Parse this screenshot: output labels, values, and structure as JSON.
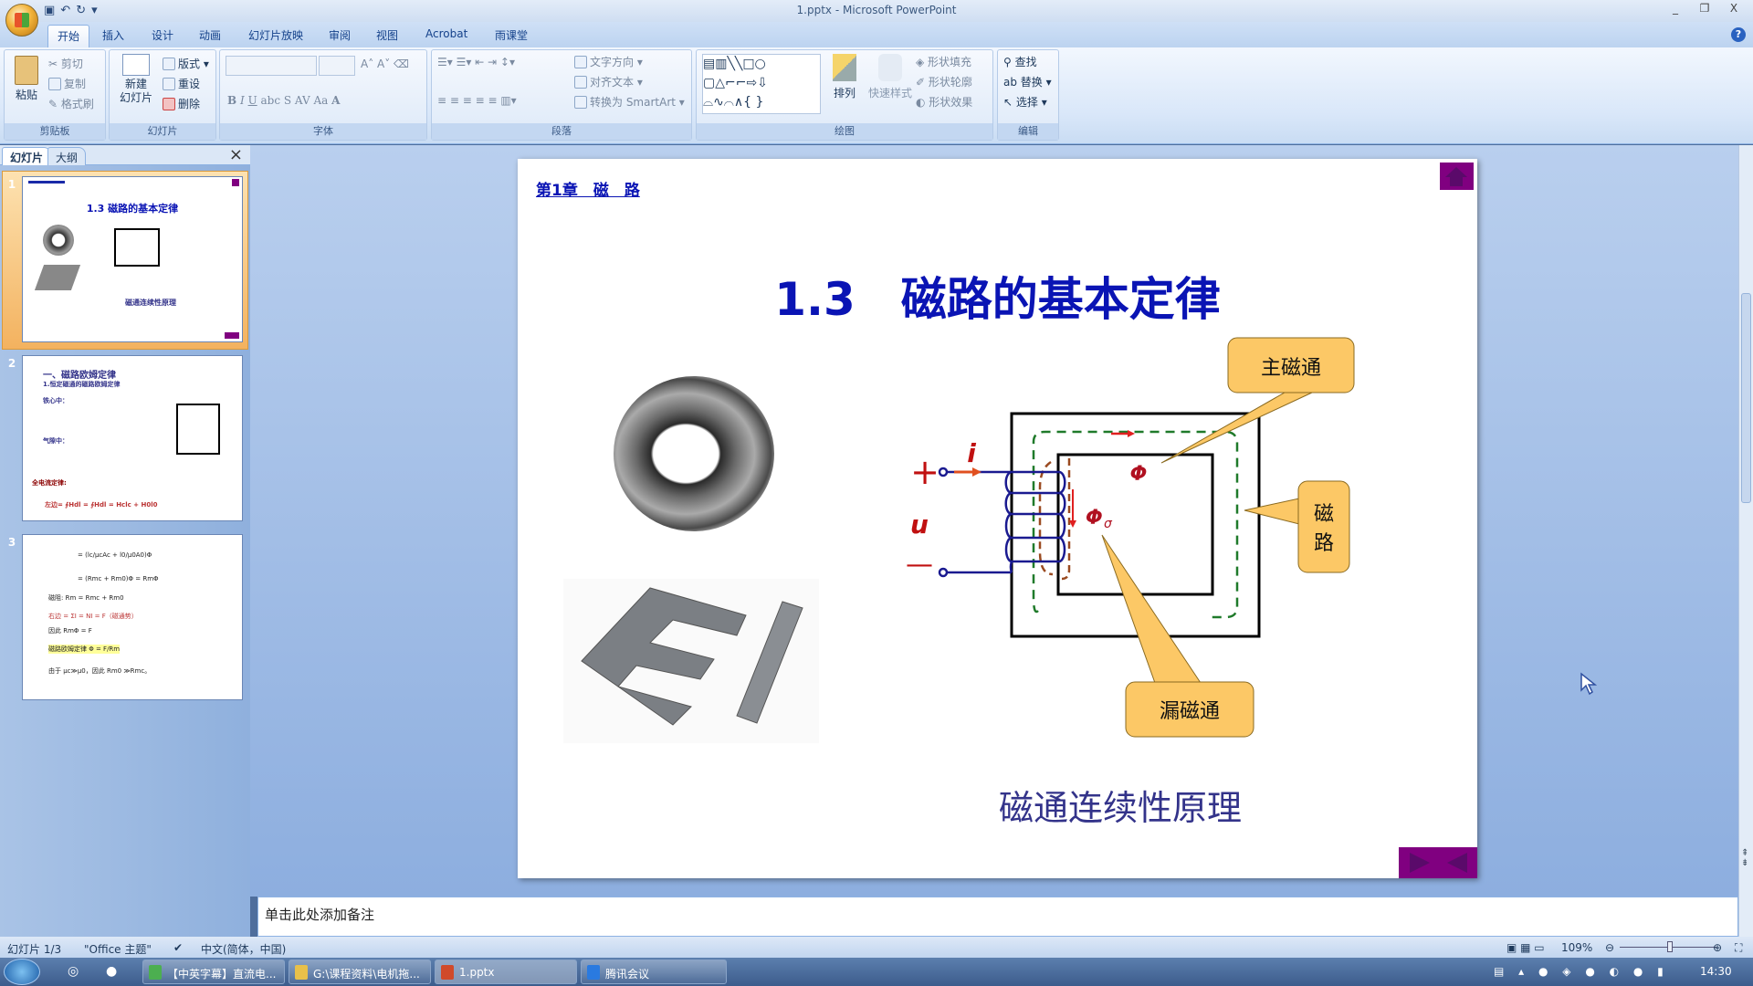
{
  "window": {
    "title": "1.pptx - Microsoft PowerPoint",
    "minimize": "_",
    "restore": "❐",
    "close": "X"
  },
  "ribbon_tabs": [
    "开始",
    "插入",
    "设计",
    "动画",
    "幻灯片放映",
    "审阅",
    "视图",
    "Acrobat",
    "雨课堂"
  ],
  "ribbon": {
    "clipboard": {
      "label": "剪贴板",
      "paste": "粘贴",
      "cut": "剪切",
      "copy": "复制",
      "format_painter": "格式刷"
    },
    "slides": {
      "label": "幻灯片",
      "new_slide": "新建\n幻灯片",
      "layout": "版式",
      "reset": "重设",
      "delete": "删除"
    },
    "font": {
      "label": "字体",
      "font_name": "",
      "font_size": ""
    },
    "paragraph": {
      "label": "段落",
      "text_direction": "文字方向",
      "align_text": "对齐文本",
      "smartart": "转换为 SmartArt"
    },
    "drawing": {
      "label": "绘图",
      "arrange": "排列",
      "quick_styles": "快速样式",
      "shape_fill": "形状填充",
      "shape_outline": "形状轮廓",
      "shape_effects": "形状效果"
    },
    "editing": {
      "label": "编辑",
      "find": "查找",
      "replace": "替换",
      "select": "选择"
    }
  },
  "left_pane": {
    "tabs": [
      "幻灯片",
      "大纲"
    ],
    "close": "×",
    "thumbnails": [
      {
        "number": "1",
        "title": "1.3 磁路的基本定律",
        "caption": "磁通连续性原理"
      },
      {
        "number": "2",
        "heading": "一、磁路欧姆定律",
        "sub": "1.恒定磁通的磁路欧姆定律",
        "lines": [
          "铁心中：",
          "气隙中：",
          "全电流定律:",
          "左边= ∮Hdl = ∮Hdl = Hclc + H0l0"
        ]
      },
      {
        "number": "3",
        "lines": [
          "= (lc/μcAc + l0/μ0A0)Φ",
          "= (Rmc + Rm0)Φ = RmΦ",
          "磁阻: Rm = Rmc + Rm0",
          "右边 = ΣI = NI = F（磁通势）",
          "因此 RmΦ = F",
          "磁路欧姆定律 Φ = F/Rm",
          "由于 μc≫μ0，因此 Rm0 ≫Rmc。"
        ]
      }
    ]
  },
  "slide": {
    "chapter_link": "第1章　磁　路",
    "title": "1.3　磁路的基本定律",
    "subtitle": "磁通连续性原理",
    "diagram": {
      "plus": "+",
      "minus": "—",
      "current": "i",
      "voltage": "u",
      "flux": "Φ",
      "leakage_flux": "Φ",
      "leakage_sub": "σ",
      "callouts": {
        "main_flux": "主磁通",
        "magnetic_path_1": "磁",
        "magnetic_path_2": "路",
        "leakage": "漏磁通"
      }
    },
    "colors": {
      "title": "#0a14b4",
      "callout": "#fcc866",
      "nav": "#800080"
    }
  },
  "notes": {
    "placeholder": "单击此处添加备注"
  },
  "status": {
    "slide": "幻灯片 1/3",
    "theme": "\"Office 主题\"",
    "language": "中文(简体，中国)",
    "zoom": "109%"
  },
  "zoom_level": 109,
  "taskbar": {
    "items": [
      "【中英字幕】直流电...",
      "G:\\课程资料\\电机拖...",
      "1.pptx",
      "腾讯会议"
    ],
    "clock": "14:30"
  }
}
